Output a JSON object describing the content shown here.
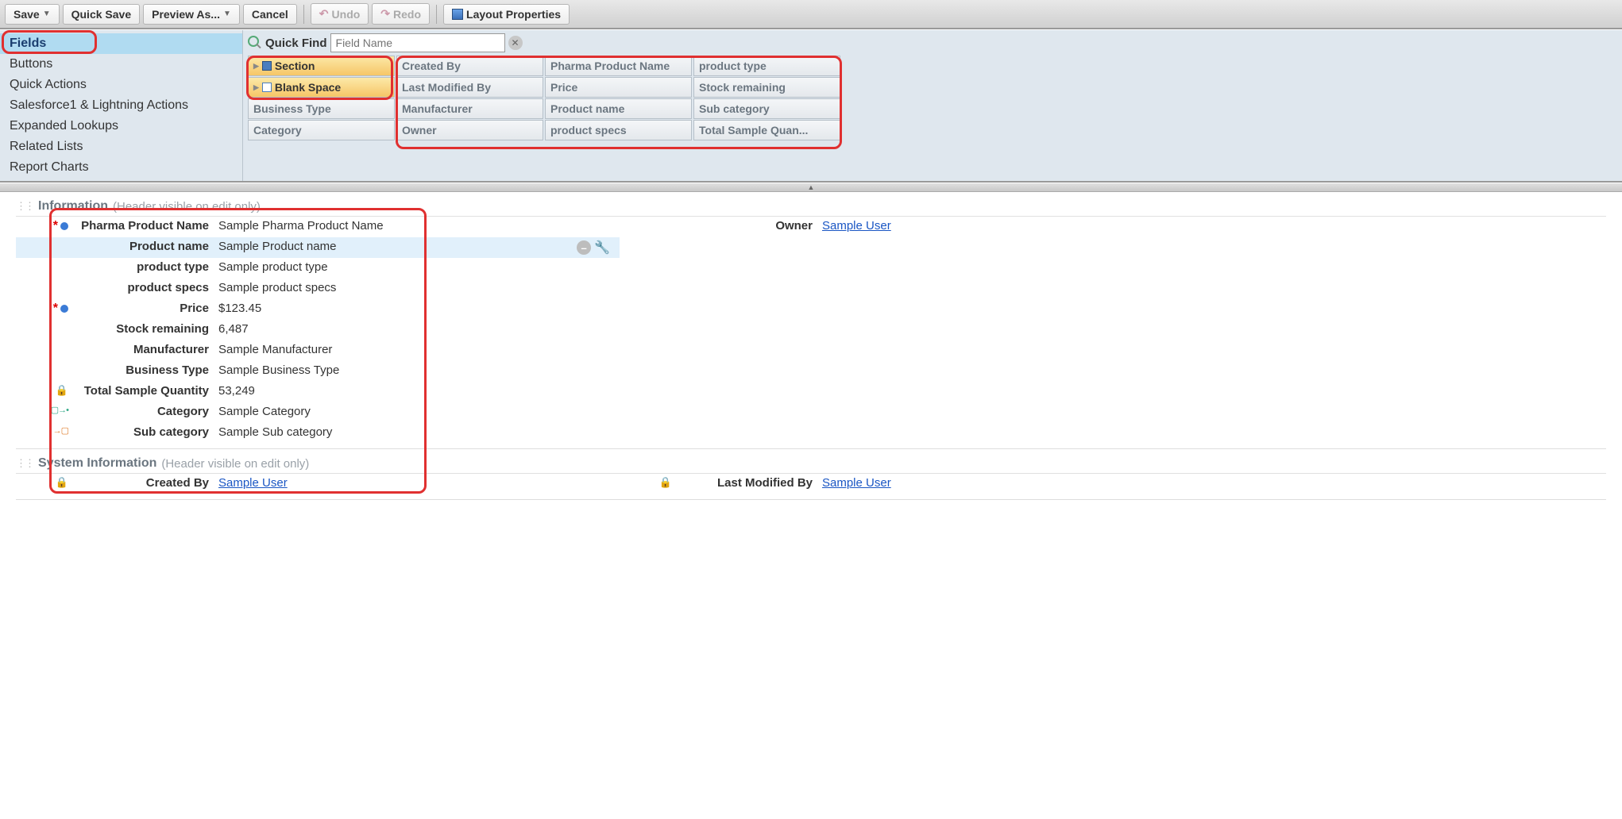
{
  "toolbar": {
    "save": "Save",
    "quick_save": "Quick Save",
    "preview_as": "Preview As...",
    "cancel": "Cancel",
    "undo": "Undo",
    "redo": "Redo",
    "layout_props": "Layout Properties"
  },
  "sidebar": {
    "items": [
      "Fields",
      "Buttons",
      "Quick Actions",
      "Salesforce1 & Lightning Actions",
      "Expanded Lookups",
      "Related Lists",
      "Report Charts"
    ]
  },
  "quickfind": {
    "label": "Quick Find",
    "placeholder": "Field Name"
  },
  "palette": {
    "col0": [
      "Section",
      "Blank Space",
      "Business Type",
      "Category"
    ],
    "col1": [
      "Created By",
      "Last Modified By",
      "Manufacturer",
      "Owner"
    ],
    "col2": [
      "Pharma Product Name",
      "Price",
      "Product name",
      "product specs"
    ],
    "col3": [
      "product type",
      "Stock remaining",
      "Sub category",
      "Total Sample Quan..."
    ]
  },
  "info_section": {
    "title": "Information",
    "subtitle": "(Header visible on edit only)",
    "left_fields": [
      {
        "label": "Pharma Product Name",
        "value": "Sample Pharma Product Name",
        "required": true,
        "dot": true
      },
      {
        "label": "Product name",
        "value": "Sample Product name",
        "highlight": true
      },
      {
        "label": "product type",
        "value": "Sample product type"
      },
      {
        "label": "product specs",
        "value": "Sample product specs"
      },
      {
        "label": "Price",
        "value": "$123.45",
        "required": true,
        "dot": true
      },
      {
        "label": "Stock remaining",
        "value": "6,487"
      },
      {
        "label": "Manufacturer",
        "value": "Sample Manufacturer"
      },
      {
        "label": "Business Type",
        "value": "Sample Business Type"
      },
      {
        "label": "Total Sample Quantity",
        "value": "53,249",
        "lock": true
      },
      {
        "label": "Category",
        "value": "Sample Category",
        "arrow": "green"
      },
      {
        "label": "Sub category",
        "value": "Sample Sub category",
        "arrow": "orange"
      }
    ],
    "right_fields": [
      {
        "label": "Owner",
        "value": "Sample User",
        "link": true
      }
    ]
  },
  "sys_section": {
    "title": "System Information",
    "subtitle": "(Header visible on edit only)",
    "left": {
      "label": "Created By",
      "value": "Sample User"
    },
    "right": {
      "label": "Last Modified By",
      "value": "Sample User"
    }
  }
}
